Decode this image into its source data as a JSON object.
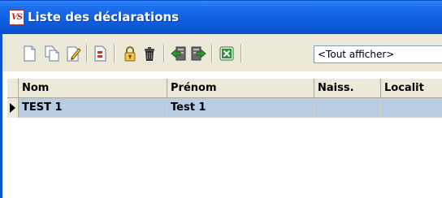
{
  "window": {
    "title": "Liste des déclarations",
    "app_icon_text": "VS"
  },
  "toolbar": {
    "buttons": [
      {
        "name": "new-document",
        "icon": "new-document-icon"
      },
      {
        "name": "copy-document",
        "icon": "copy-document-icon"
      },
      {
        "name": "edit-document",
        "icon": "edit-document-icon"
      },
      {
        "name": "print-preview",
        "icon": "document-icon"
      },
      {
        "name": "lock",
        "icon": "lock-icon"
      },
      {
        "name": "delete",
        "icon": "trash-icon"
      },
      {
        "name": "import",
        "icon": "import-icon"
      },
      {
        "name": "export",
        "icon": "export-icon"
      },
      {
        "name": "excel",
        "icon": "excel-icon"
      }
    ],
    "filter_value": "<Tout afficher>"
  },
  "grid": {
    "columns": [
      "Nom",
      "Prénom",
      "Naiss.",
      "Localit"
    ],
    "rows": [
      {
        "nom": "TEST 1",
        "prenom": "Test 1",
        "naiss": "",
        "localite": ""
      }
    ]
  },
  "colors": {
    "title_bar": "#0b55d2",
    "selected_row": "#b8cce4",
    "toolbar_bg": "#ece9d8"
  }
}
